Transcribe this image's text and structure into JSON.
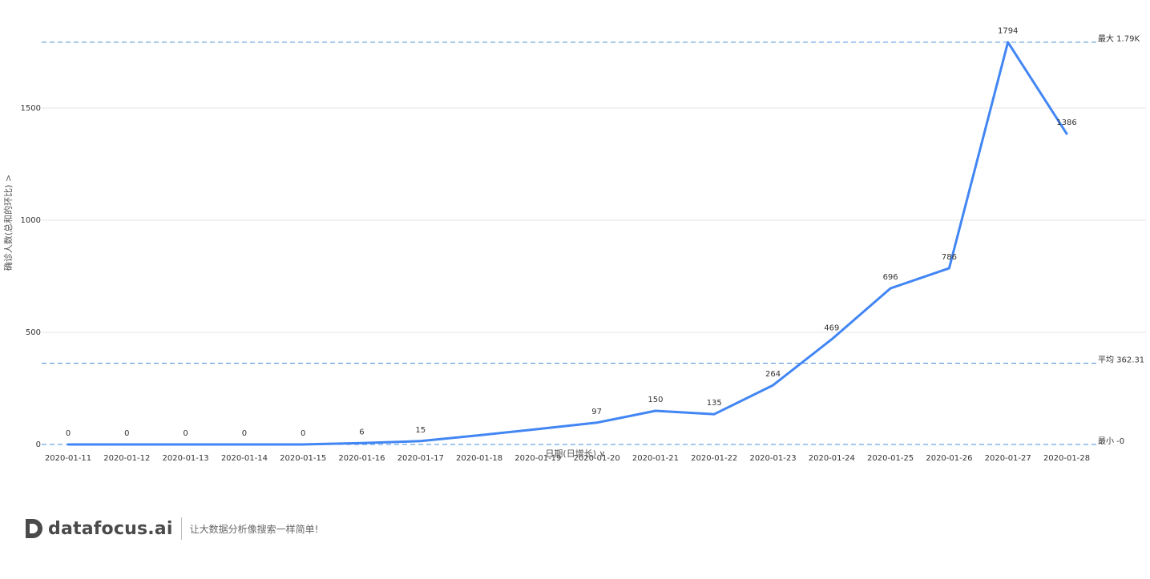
{
  "chart_data": {
    "type": "line",
    "xlabel": "日期(日增长)",
    "xlabel_suffix": "∨",
    "ylabel": "确诊人数(总和的环比)",
    "ylabel_suffix": ">",
    "categories": [
      "2020-01-11",
      "2020-01-12",
      "2020-01-13",
      "2020-01-14",
      "2020-01-15",
      "2020-01-16",
      "2020-01-17",
      "2020-01-18",
      "2020-01-19",
      "2020-01-20",
      "2020-01-21",
      "2020-01-22",
      "2020-01-23",
      "2020-01-24",
      "2020-01-25",
      "2020-01-26",
      "2020-01-27",
      "2020-01-28"
    ],
    "values": [
      0,
      0,
      0,
      0,
      0,
      6,
      15,
      41,
      69,
      97,
      150,
      135,
      264,
      469,
      696,
      786,
      1794,
      1386
    ],
    "data_labels": [
      "0",
      "0",
      "0",
      "0",
      "0",
      "6",
      "15",
      "",
      "",
      "97",
      "150",
      "135",
      "264",
      "469",
      "696",
      "786",
      "1794",
      "1386"
    ],
    "ylim": [
      0,
      1850
    ],
    "yticks": [
      0,
      500,
      1000,
      1500
    ],
    "grid": true,
    "line_color": "#4286f4",
    "reference_lines": [
      {
        "label": "最大 1.79K",
        "value": 1794
      },
      {
        "label": "平均 362.31",
        "value": 362.31
      },
      {
        "label": "最小 -0",
        "value": 0
      }
    ],
    "reference_color": "#4a90d9"
  },
  "footer": {
    "brand": "datafocus.ai",
    "slogan": "让大数据分析像搜索一样简单!"
  }
}
